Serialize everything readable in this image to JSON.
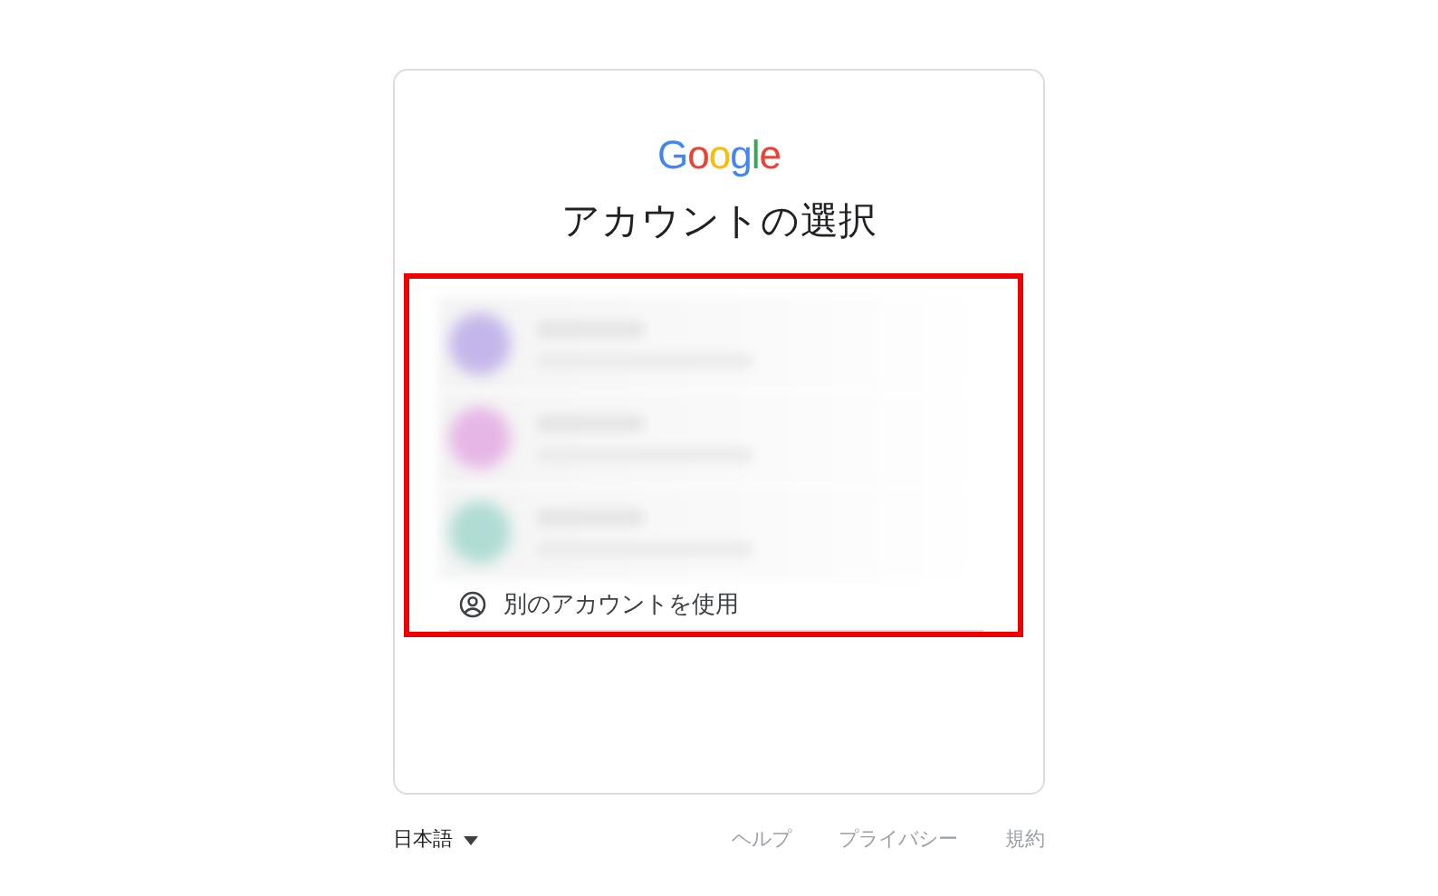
{
  "logo": "Google",
  "title": "アカウントの選択",
  "accounts": [
    {
      "color": "#c4b6ea"
    },
    {
      "color": "#e6b6e6"
    },
    {
      "color": "#afdcd4"
    }
  ],
  "use_other_account": "別のアカウントを使用",
  "footer": {
    "language": "日本語",
    "links": [
      "ヘルプ",
      "プライバシー",
      "規約"
    ]
  }
}
